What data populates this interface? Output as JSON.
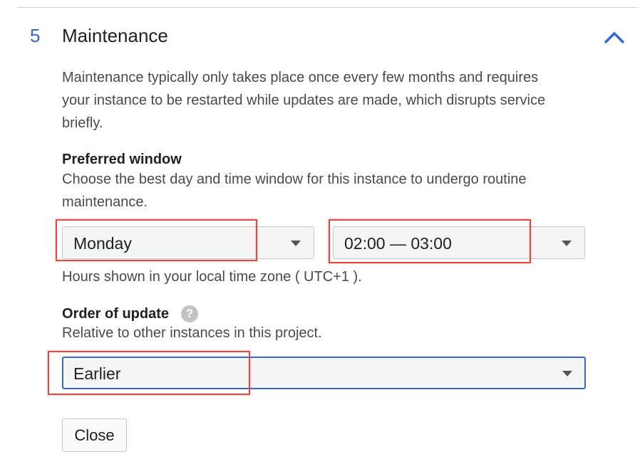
{
  "section": {
    "number": "5",
    "title": "Maintenance",
    "description": "Maintenance typically only takes place once every few months and requires your instance to be restarted while updates are made, which disrupts service briefly."
  },
  "preferred_window": {
    "label": "Preferred window",
    "description": "Choose the best day and time window for this instance to undergo routine maintenance.",
    "day_select": {
      "value": "Monday"
    },
    "time_select": {
      "value": "02:00 — 03:00"
    },
    "timezone_note": "Hours shown in your local time zone ( UTC+1 )."
  },
  "order_of_update": {
    "label": "Order of update",
    "help_glyph": "?",
    "description": "Relative to other instances in this project.",
    "select": {
      "value": "Earlier"
    }
  },
  "actions": {
    "close_label": "Close"
  },
  "icons": {
    "collapse": "chevron-up-icon",
    "help": "help-icon",
    "dropdown": "caret-down-icon"
  },
  "colors": {
    "accent": "#3367d6",
    "highlight": "#e8473d"
  }
}
